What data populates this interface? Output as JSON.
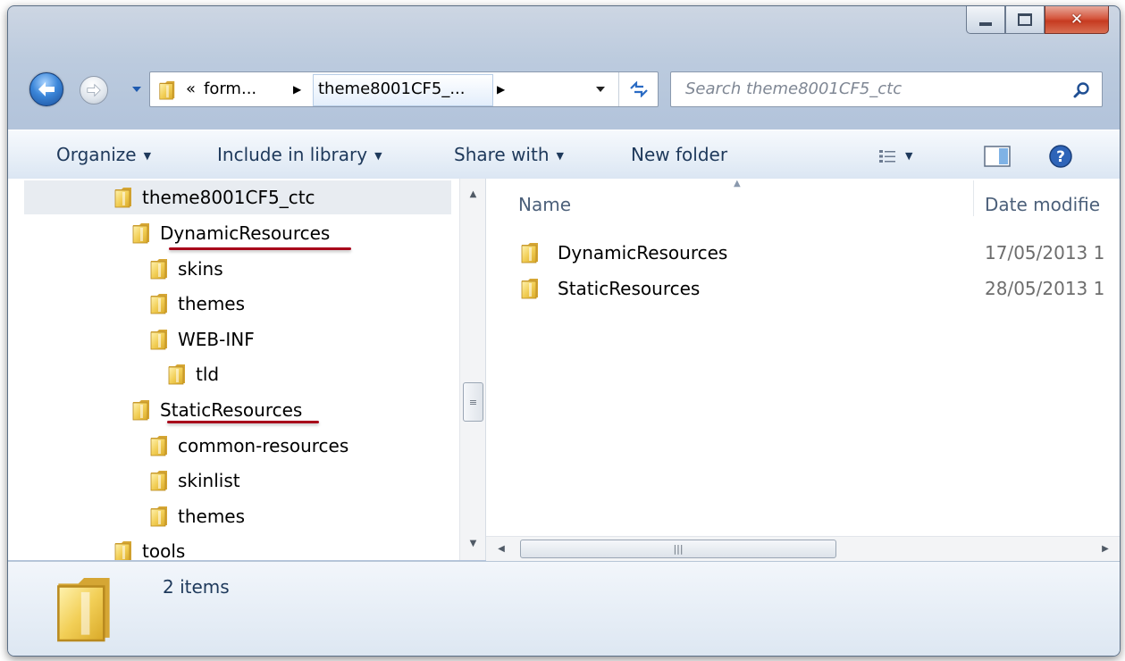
{
  "window": {
    "minimize_icon": "minimize-icon",
    "maximize_icon": "maximize-icon",
    "close_icon": "close-icon"
  },
  "address_bar": {
    "overflow": "«",
    "crumbs": [
      "form...",
      "theme8001CF5_..."
    ],
    "folder_icon": "folder-icon",
    "refresh_icon": "refresh-icon"
  },
  "search": {
    "placeholder": "Search theme8001CF5_ctc",
    "icon": "search-icon"
  },
  "toolbar": {
    "organize": "Organize",
    "include_in_library": "Include in library",
    "share_with": "Share with",
    "new_folder": "New folder",
    "views_icon": "details-view-icon",
    "preview_icon": "preview-pane-icon",
    "help_icon": "help-icon"
  },
  "nav_tree": {
    "items": [
      {
        "label": "theme8001CF5_ctc",
        "selected": true
      },
      {
        "label": "DynamicResources",
        "underlined": true
      },
      {
        "label": "skins"
      },
      {
        "label": "themes"
      },
      {
        "label": "WEB-INF"
      },
      {
        "label": "tld"
      },
      {
        "label": "StaticResources",
        "underlined": true
      },
      {
        "label": "common-resources"
      },
      {
        "label": "skinlist"
      },
      {
        "label": "themes"
      },
      {
        "label": "tools"
      }
    ]
  },
  "file_list": {
    "columns": [
      "Name",
      "Date modifie"
    ],
    "rows": [
      {
        "name": "DynamicResources",
        "date": "17/05/2013 1"
      },
      {
        "name": "StaticResources",
        "date": "28/05/2013 1"
      }
    ]
  },
  "details_pane": {
    "count": "2 items"
  },
  "colors": {
    "underline": "#a8001a",
    "folder": "#f2c94c"
  }
}
